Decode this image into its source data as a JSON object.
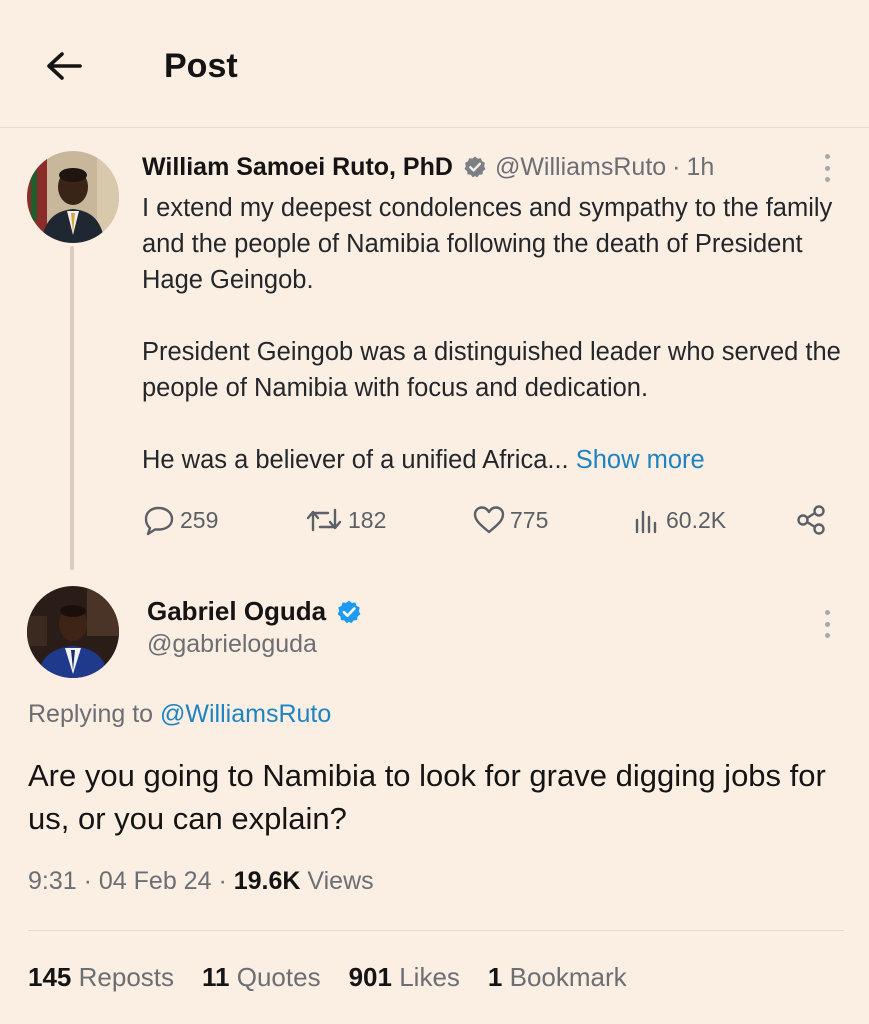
{
  "header": {
    "title": "Post"
  },
  "parent_post": {
    "name": "William Samoei Ruto, PhD",
    "handle": "@WilliamsRuto",
    "separator": "·",
    "time": "1h",
    "body": [
      "I extend my deepest condolences and sympathy to the family and the people of Namibia following the death of President Hage Geingob.",
      "President Geingob was a distinguished leader who served the people of Namibia with focus and dedication."
    ],
    "last_line": "He was a believer of a unified Africa...",
    "show_more": "Show more",
    "actions": {
      "replies": "259",
      "reposts": "182",
      "likes": "775",
      "views": "60.2K"
    }
  },
  "reply_post": {
    "name": "Gabriel Oguda",
    "handle": "@gabrieloguda",
    "replying_prefix": "Replying to",
    "replying_to": "@WilliamsRuto",
    "text": "Are you going to Namibia to look for grave digging jobs for us, or you can explain?",
    "time": "9:31",
    "date": "04 Feb 24",
    "views_count": "19.6K",
    "views_label": "Views",
    "dot": "·"
  },
  "stats": {
    "reposts_count": "145",
    "reposts_label": "Reposts",
    "quotes_count": "11",
    "quotes_label": "Quotes",
    "likes_count": "901",
    "likes_label": "Likes",
    "bookmarks_count": "1",
    "bookmarks_label": "Bookmark"
  },
  "colors": {
    "background": "#fbeee2",
    "link": "#1d84c4",
    "verified": "#1d9bf0",
    "muted_text": "#6b6f74"
  },
  "icons": {
    "back": "arrow-left-icon",
    "verified": "verified-badge-icon",
    "more": "more-vertical-icon",
    "reply": "reply-icon",
    "repost": "repost-icon",
    "like": "heart-icon",
    "views": "views-chart-icon",
    "share": "share-icon"
  }
}
